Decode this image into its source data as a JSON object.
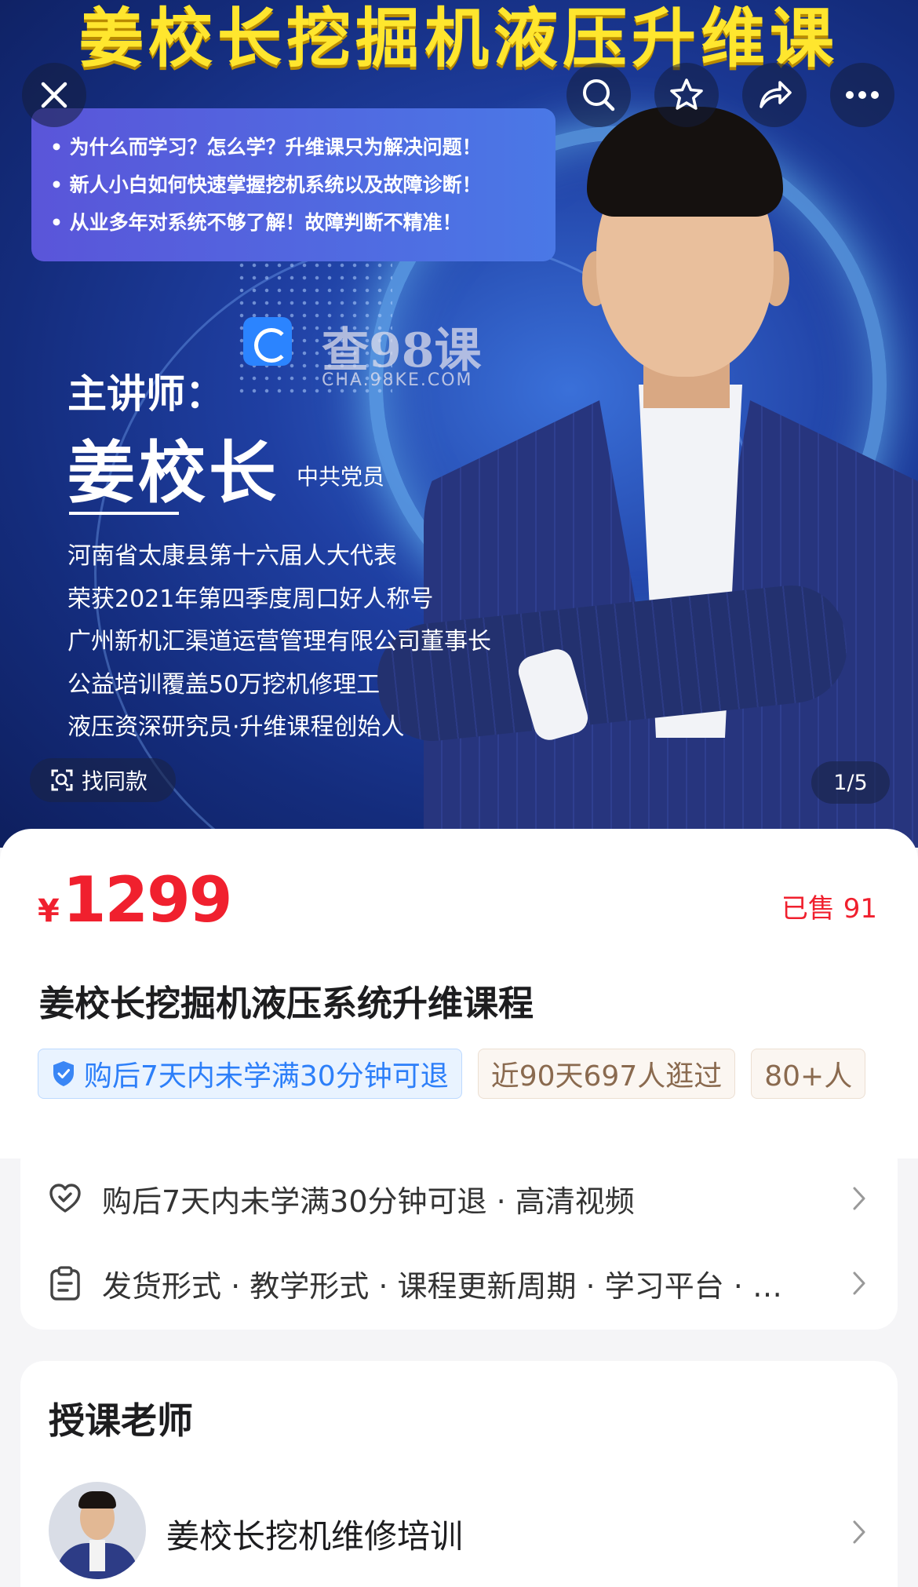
{
  "hero": {
    "banner_title": "姜校长挖掘机液压升维课",
    "bullets": [
      "• 为什么而学习？怎么学？升维课只为解决问题！",
      "• 新人小白如何快速掌握挖机系统以及故障诊断！",
      "• 从业多年对系统不够了解！故障判断不精准！"
    ],
    "watermark": {
      "text": "查98课",
      "url": "CHA.98KE.COM"
    },
    "lecturer_label": "主讲师：",
    "lecturer_name": "姜校长",
    "lecturer_party": "中共党员",
    "credentials": [
      "河南省太康县第十六届人大代表",
      "荣获2021年第四季度周口好人称号",
      "广州新机汇渠道运营管理有限公司董事长",
      "公益培训覆盖50万挖机修理工",
      "液压资深研究员·升维课程创始人"
    ],
    "find_same_label": "找同款",
    "pager": "1/5",
    "icons": [
      "close-icon",
      "search-icon",
      "star-icon",
      "share-icon",
      "more-icon",
      "scan-icon"
    ]
  },
  "product": {
    "currency": "¥",
    "price": "1299",
    "sold": "已售 91",
    "title": "姜校长挖掘机液压系统升维课程",
    "tags": {
      "refund": "购后7天内未学满30分钟可退",
      "visits": "近90天697人逛过",
      "more": "80+人"
    }
  },
  "services": {
    "refund_row": "购后7天内未学满30分钟可退 · 高清视频",
    "details_row": "发货形式 · 教学形式 · 课程更新周期 · 学习平台 · …"
  },
  "teacher": {
    "heading": "授课老师",
    "name": "姜校长挖机维修培训"
  },
  "colors": {
    "price_red": "#f0202e",
    "banner_yellow": "#ffe62e",
    "refund_blue": "#2d7ff9"
  }
}
